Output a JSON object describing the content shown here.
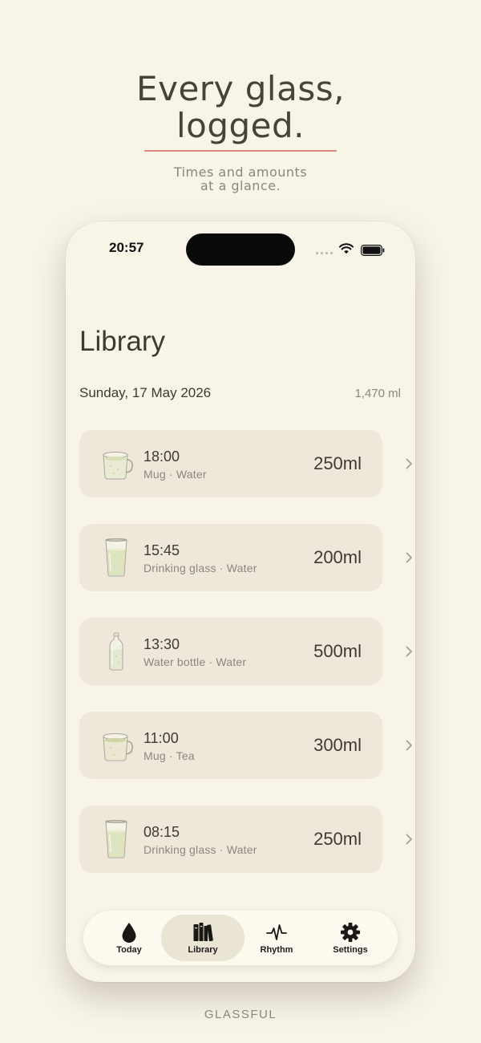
{
  "headline": {
    "line1": "Every glass,",
    "line2": "logged.",
    "sub_line1": "Times and amounts",
    "sub_line2": "at a glance."
  },
  "status_bar": {
    "time": "20:57"
  },
  "screen": {
    "title": "Library",
    "date": "Sunday, 17 May 2026",
    "total": "1,470 ml"
  },
  "entries": [
    {
      "time": "18:00",
      "detail": "Mug · Water",
      "amount": "250ml",
      "icon": "mug-icon"
    },
    {
      "time": "15:45",
      "detail": "Drinking glass · Water",
      "amount": "200ml",
      "icon": "drinking-glass-icon"
    },
    {
      "time": "13:30",
      "detail": "Water bottle · Water",
      "amount": "500ml",
      "icon": "water-bottle-icon"
    },
    {
      "time": "11:00",
      "detail": "Mug · Tea",
      "amount": "300ml",
      "icon": "mug-icon"
    },
    {
      "time": "08:15",
      "detail": "Drinking glass · Water",
      "amount": "250ml",
      "icon": "drinking-glass-icon"
    }
  ],
  "tab_bar": {
    "tabs": [
      {
        "label": "Today",
        "icon": "water-drop-icon",
        "active": false
      },
      {
        "label": "Library",
        "icon": "books-icon",
        "active": true
      },
      {
        "label": "Rhythm",
        "icon": "pulse-icon",
        "active": false
      },
      {
        "label": "Settings",
        "icon": "gear-icon",
        "active": false
      }
    ]
  },
  "footer": {
    "brand": "GLASSFUL"
  },
  "colors": {
    "background": "#f8f4e8",
    "card": "#efe8da",
    "accent_rule": "#d98a7a",
    "active_tab": "#e9e4d4"
  }
}
